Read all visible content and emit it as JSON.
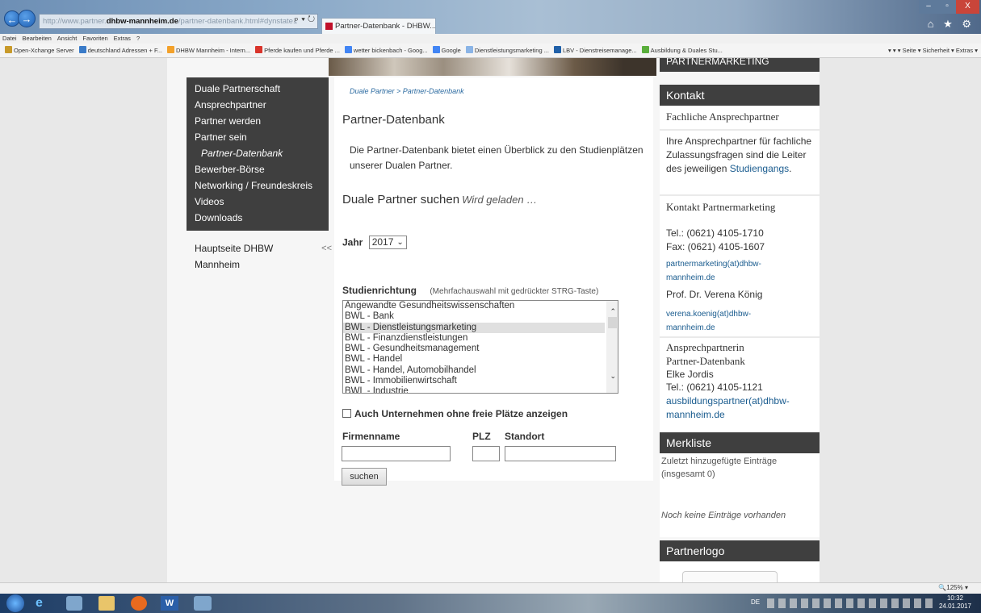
{
  "browser": {
    "url_prefix": "http://www.partner.",
    "url_domain": "dhbw-mannheim.de",
    "url_path": "/partner-datenbank.html#dynstate1",
    "search_icons": "⌕ ▾ ↻",
    "tab_title": "Partner-Datenbank - DHBW... ×",
    "window_buttons": {
      "minimize": "‒",
      "maximize": "▫",
      "close": "X"
    },
    "chrome_icons": "⌂ ★ ⚙",
    "menu": [
      "Datei",
      "Bearbeiten",
      "Ansicht",
      "Favoriten",
      "Extras",
      "?"
    ],
    "favorites": [
      {
        "label": "Open-Xchange Server",
        "color": "#c89a2a"
      },
      {
        "label": "deutschland Adressen + F...",
        "color": "#3a7bc8"
      },
      {
        "label": "DHBW Mannheim - Intern...",
        "color": "#f3a12a"
      },
      {
        "label": "Pferde kaufen und Pferde ...",
        "color": "#d9342b"
      },
      {
        "label": "wetter bickenbach - Goog...",
        "color": "#4285f4"
      },
      {
        "label": "Google",
        "color": "#4285f4"
      },
      {
        "label": "Dienstleistungsmarketing ...",
        "color": "#8ab4e6"
      },
      {
        "label": "LBV - Dienstreisemanage...",
        "color": "#2060a8"
      },
      {
        "label": "Ausbildung & Duales Stu...",
        "color": "#5aae3c"
      }
    ],
    "favbar_right": "▾ ▾ ▾ Seite ▾  Sicherheit ▾  Extras ▾"
  },
  "nav": {
    "items": [
      {
        "label": "Duale Partnerschaft",
        "sub": false
      },
      {
        "label": "Ansprechpartner",
        "sub": false
      },
      {
        "label": "Partner werden",
        "sub": false
      },
      {
        "label": "Partner sein",
        "sub": false
      },
      {
        "label": "Partner-Datenbank",
        "sub": true
      },
      {
        "label": "Bewerber-Börse",
        "sub": false
      },
      {
        "label": "Networking / Freundeskreis",
        "sub": false
      },
      {
        "label": "Videos",
        "sub": false
      },
      {
        "label": "Downloads",
        "sub": false
      }
    ],
    "hauptseite_line1": "Hauptseite DHBW",
    "hauptseite_line2": "Mannheim",
    "hauptseite_arrow": "<<"
  },
  "main": {
    "breadcrumb": "Duale Partner > Partner-Datenbank",
    "title": "Partner-Datenbank",
    "intro": "Die Partner-Datenbank bietet einen Überblick zu den Studienplätzen unserer Dualen Partner.",
    "search_heading": "Duale Partner suchen",
    "loading": "Wird geladen …",
    "jahr_label": "Jahr",
    "jahr_value": "2017",
    "studien_label": "Studienrichtung",
    "studien_hint": "(Mehrfachauswahl mit gedrückter STRG-Taste)",
    "studien_options": [
      "Angewandte Gesundheitswissenschaften",
      "BWL - Bank",
      "BWL - Dienstleistungsmarketing",
      "BWL - Finanzdienstleistungen",
      "BWL - Gesundheitsmanagement",
      "BWL - Handel",
      "BWL - Handel, Automobilhandel",
      "BWL - Immobilienwirtschaft",
      "BWL - Industrie"
    ],
    "selected_option": "BWL - Dienstleistungsmarketing",
    "auch_label": "Auch Unternehmen ohne freie Plätze anzeigen",
    "firmenname_label": "Firmenname",
    "plz_label": "PLZ",
    "standort_label": "Standort",
    "firmenname_value": "",
    "plz_value": "",
    "standort_value": "",
    "search_button": "suchen"
  },
  "sidebar": {
    "partnermarketing_head": "PARTNERMARKETING",
    "kontakt_head": "Kontakt",
    "fachliche_head": "Fachliche Ansprechpartner",
    "fachliche_text": "Ihre Ansprechpartner für fachliche Zulassungsfragen sind die Leiter des jeweiligen",
    "studiengang_link": "Studiengangs",
    "kontakt_pm_head": "Kontakt Partnermarketing",
    "tel": "Tel.: (0621) 4105-1710",
    "fax": "Fax: (0621) 4105-1607",
    "pm_email_1": "partnermarketing(at)dhbw-",
    "pm_email_2": "mannheim.de",
    "prof": "Prof. Dr. Verena König",
    "prof_email_1": "verena.koenig(at)dhbw-",
    "prof_email_2": "mannheim.de",
    "ansprech_head_1": "Ansprechpartnerin",
    "ansprech_head_2": "Partner-Datenbank",
    "ansprech_name": "Elke Jordis",
    "ansprech_tel": "Tel.: (0621) 4105-1121",
    "ansprech_email_1": "ausbildungspartner(at)dhbw-",
    "ansprech_email_2": "mannheim.de",
    "merkliste_head": "Merkliste",
    "merkliste_text_1": "Zuletzt hinzugefügte Einträge",
    "merkliste_text_2": "(insgesamt 0)",
    "merkliste_empty": "Noch keine Einträge vorhanden",
    "partnerlogo_head": "Partnerlogo"
  },
  "statusbar": {
    "zoom": "125%"
  },
  "taskbar": {
    "lang": "DE",
    "time": "10:32",
    "date": "24.01.2017"
  }
}
